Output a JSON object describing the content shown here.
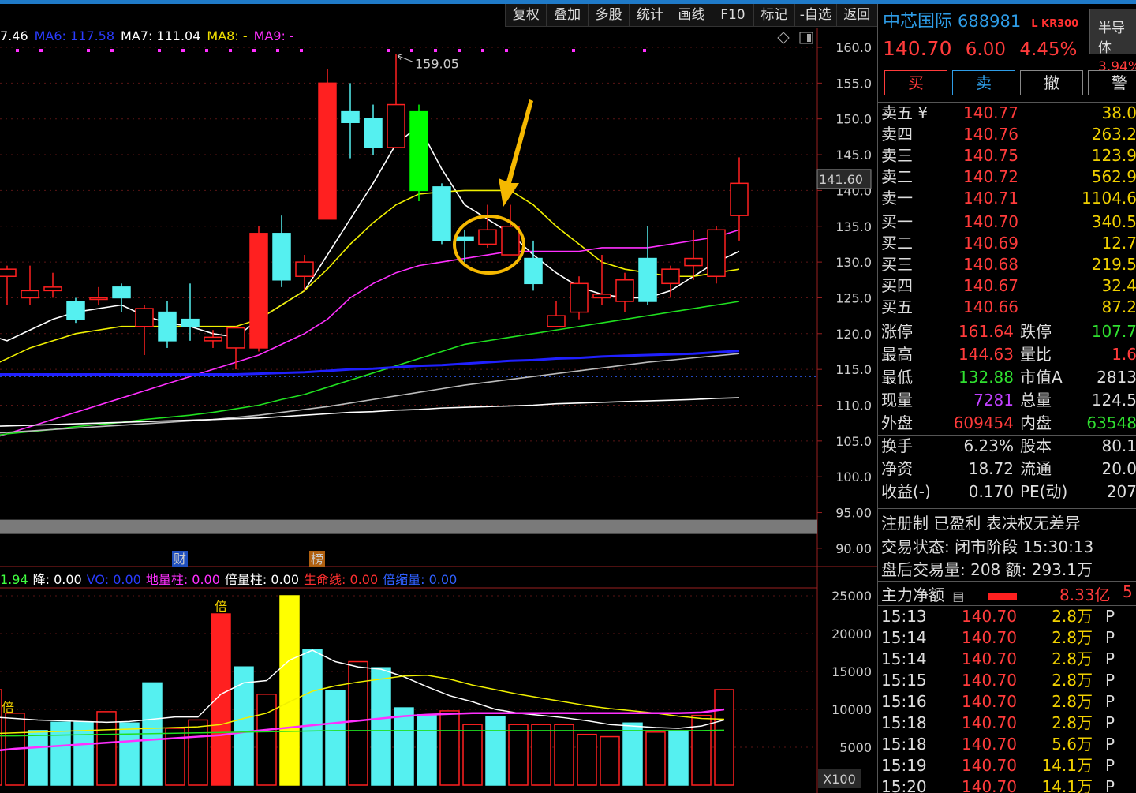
{
  "toolbar": [
    "复权",
    "叠加",
    "多股",
    "统计",
    "画线",
    "F10",
    "标记",
    "-自选",
    "返回"
  ],
  "ma_legend": [
    {
      "text": "7.46",
      "color": "#ffffff"
    },
    {
      "text": "MA6: 117.58",
      "color": "#2a3cff"
    },
    {
      "text": "MA7: 111.04",
      "color": "#ffffff"
    },
    {
      "text": "MA8: -",
      "color": "#f0e000"
    },
    {
      "text": "MA9: -",
      "color": "#ff30ff"
    }
  ],
  "indicator_legend": [
    {
      "text": "1.94",
      "color": "#40ff40"
    },
    {
      "text": "降: 0.00",
      "color": "#ffffff"
    },
    {
      "text": "VO: 0.00",
      "color": "#2a3cff"
    },
    {
      "text": "地量柱: 0.00",
      "color": "#ff30ff"
    },
    {
      "text": "倍量柱: 0.00",
      "color": "#ffffff"
    },
    {
      "text": "生命线: 0.00",
      "color": "#ff3030"
    },
    {
      "text": "倍缩量: 0.00",
      "color": "#3060ff"
    }
  ],
  "colors": {
    "up": "#ff2020",
    "down": "#55f0f0",
    "green": "#00ff00",
    "ma_white": "#ffffff",
    "ma_yellow": "#f0f000",
    "ma_magenta": "#ff30ff",
    "ma_green": "#20e020",
    "ma_blue": "#2020ff",
    "ma_gray": "#bbbbbb",
    "accent": "#f5b800"
  },
  "chart_data": [
    {
      "type": "candlestick",
      "ylim": [
        90,
        160
      ],
      "y_ticks": [
        "160.0",
        "155.0",
        "150.0",
        "145.0",
        "140.0",
        "135.0",
        "130.0",
        "125.0",
        "120.0",
        "115.0",
        "110.0",
        "105.0",
        "100.0",
        "95.00",
        "90.00"
      ],
      "last_price_label": "141.60",
      "high_annotation": "159.05",
      "dotted_level": 114.0,
      "candles": [
        {
          "o": 121.9,
          "c": 124.8,
          "h": 126.0,
          "l": 121.0
        },
        {
          "o": 128.0,
          "c": 129.0,
          "h": 129.5,
          "l": 124.0
        },
        {
          "o": 125.0,
          "c": 126.0,
          "h": 129.5,
          "l": 124.0
        },
        {
          "o": 126.0,
          "c": 126.5,
          "h": 128.5,
          "l": 125.0
        },
        {
          "o": 124.5,
          "c": 122.0,
          "h": 125.0,
          "l": 121.5
        },
        {
          "o": 125.0,
          "c": 125.0,
          "h": 126.5,
          "l": 124.0
        },
        {
          "o": 126.5,
          "c": 125.0,
          "h": 127.0,
          "l": 123.0
        },
        {
          "o": 121.0,
          "c": 123.5,
          "h": 124.0,
          "l": 117.0
        },
        {
          "o": 123.0,
          "c": 119.0,
          "h": 124.5,
          "l": 118.0
        },
        {
          "o": 122.0,
          "c": 121.0,
          "h": 127.0,
          "l": 119.0
        },
        {
          "o": 119.0,
          "c": 119.5,
          "h": 120.5,
          "l": 118.0
        },
        {
          "o": 118.0,
          "c": 120.8,
          "h": 121.0,
          "l": 115.0
        },
        {
          "o": 118.0,
          "c": 134.0,
          "h": 135.0,
          "l": 117.5
        },
        {
          "o": 134.0,
          "c": 127.5,
          "h": 136.5,
          "l": 126.5
        },
        {
          "o": 128.0,
          "c": 130.0,
          "h": 131.0,
          "l": 126.0
        },
        {
          "o": 136.0,
          "c": 155.0,
          "h": 157.0,
          "l": 136.0
        },
        {
          "o": 151.0,
          "c": 149.5,
          "h": 155.0,
          "l": 144.5
        },
        {
          "o": 150.0,
          "c": 146.0,
          "h": 152.0,
          "l": 145.0
        },
        {
          "o": 146.0,
          "c": 152.0,
          "h": 159.05,
          "l": 146.0
        },
        {
          "o": 151.0,
          "c": 140.0,
          "h": 152.0,
          "l": 138.5
        },
        {
          "o": 140.5,
          "c": 133.0,
          "h": 141.0,
          "l": 132.5
        },
        {
          "o": 133.5,
          "c": 133.0,
          "h": 134.5,
          "l": 130.0
        },
        {
          "o": 132.5,
          "c": 134.5,
          "h": 138.0,
          "l": 132.0
        },
        {
          "o": 131.0,
          "c": 135.0,
          "h": 138.0,
          "l": 131.0
        },
        {
          "o": 130.5,
          "c": 127.0,
          "h": 133.0,
          "l": 126.0
        },
        {
          "o": 121.0,
          "c": 122.5,
          "h": 124.5,
          "l": 121.0
        },
        {
          "o": 123.0,
          "c": 127.0,
          "h": 128.0,
          "l": 122.0
        },
        {
          "o": 125.0,
          "c": 125.5,
          "h": 131.0,
          "l": 124.0
        },
        {
          "o": 124.5,
          "c": 127.5,
          "h": 128.5,
          "l": 123.0
        },
        {
          "o": 130.5,
          "c": 124.5,
          "h": 135.0,
          "l": 124.0
        },
        {
          "o": 127.0,
          "c": 129.0,
          "h": 129.5,
          "l": 125.0
        },
        {
          "o": 129.5,
          "c": 130.5,
          "h": 134.5,
          "l": 127.5
        },
        {
          "o": 128.0,
          "c": 134.5,
          "h": 135.0,
          "l": 127.0
        },
        {
          "o": 136.5,
          "c": 141.0,
          "h": 144.63,
          "l": 133.0
        }
      ],
      "ma_lines": [
        {
          "color": "#ffffff",
          "values": [
            120,
            119,
            120.5,
            122,
            123,
            123.5,
            124,
            122.5,
            121.5,
            121,
            120,
            119.5,
            122,
            124,
            126,
            131,
            136,
            141,
            146.5,
            149,
            143,
            138,
            136,
            134,
            131,
            128.5,
            126.5,
            125.5,
            125,
            125,
            126,
            128,
            130,
            131.5
          ]
        },
        {
          "color": "#f0f000",
          "values": [
            115,
            116.5,
            118,
            119,
            120,
            120.5,
            121,
            121,
            121,
            121,
            121,
            121,
            122,
            124,
            126,
            129,
            132.5,
            135.5,
            138,
            139.5,
            139.8,
            140,
            140,
            140,
            138,
            135,
            132.5,
            130,
            129,
            128.5,
            128,
            128,
            128.5,
            129
          ]
        },
        {
          "color": "#ff30ff",
          "values": [
            105,
            106,
            107,
            108,
            109,
            110,
            111,
            112,
            113,
            114,
            115,
            116,
            117,
            118.5,
            120,
            122,
            125,
            127,
            128.5,
            129.5,
            130,
            130.5,
            131,
            131.5,
            131.5,
            131.5,
            131.5,
            132,
            132,
            132,
            132.5,
            133,
            133.5,
            134.5
          ]
        },
        {
          "color": "#20e020",
          "values": [
            105.5,
            106,
            106.3,
            106.6,
            107,
            107.3,
            107.6,
            108,
            108.3,
            108.6,
            109,
            109.5,
            110,
            110.8,
            111.5,
            112.5,
            113.5,
            114.5,
            115.5,
            116.5,
            117.5,
            118.5,
            119,
            119.5,
            120,
            120.5,
            121,
            121.5,
            122,
            122.5,
            123,
            123.5,
            124,
            124.5
          ]
        },
        {
          "color": "#2020ff",
          "values": [
            114.3,
            114.3,
            114.3,
            114.3,
            114.3,
            114.3,
            114.3,
            114.3,
            114.3,
            114.3,
            114.3,
            114.3,
            114.4,
            114.5,
            114.6,
            114.8,
            115,
            115.1,
            115.3,
            115.5,
            115.6,
            115.8,
            116,
            116.2,
            116.3,
            116.5,
            116.6,
            116.8,
            116.9,
            117,
            117.1,
            117.2,
            117.4,
            117.58
          ]
        },
        {
          "color": "#bbbbbb",
          "values": [
            106,
            106.2,
            106.4,
            106.6,
            106.8,
            107,
            107.2,
            107.4,
            107.6,
            107.8,
            108,
            108.3,
            108.6,
            109,
            109.4,
            109.8,
            110.3,
            110.8,
            111.3,
            111.8,
            112.3,
            112.8,
            113.2,
            113.6,
            114,
            114.4,
            114.8,
            115.2,
            115.6,
            116,
            116.3,
            116.6,
            116.9,
            117.2
          ]
        },
        {
          "color": "#ffffff",
          "values": [
            107,
            107.1,
            107.2,
            107.3,
            107.4,
            107.5,
            107.6,
            107.7,
            107.8,
            107.9,
            108,
            108.1,
            108.2,
            108.4,
            108.6,
            108.8,
            109,
            109.1,
            109.3,
            109.4,
            109.6,
            109.7,
            109.8,
            109.9,
            110,
            110.2,
            110.3,
            110.4,
            110.5,
            110.6,
            110.7,
            110.8,
            110.95,
            111.04
          ]
        }
      ]
    },
    {
      "type": "bar",
      "title": "",
      "ylim": [
        0,
        25000
      ],
      "y_ticks": [
        "25000",
        "20000",
        "15000",
        "10000",
        "5000"
      ],
      "unit_label": "X100",
      "markers": [
        "财",
        "榜",
        "倍",
        "倍"
      ],
      "bars": [
        {
          "v": 12600,
          "k": "up"
        },
        {
          "v": 9500,
          "k": "up"
        },
        {
          "v": 7200,
          "k": "down"
        },
        {
          "v": 8300,
          "k": "down"
        },
        {
          "v": 8300,
          "k": "down"
        },
        {
          "v": 9700,
          "k": "up"
        },
        {
          "v": 8200,
          "k": "down"
        },
        {
          "v": 13500,
          "k": "down"
        },
        {
          "v": 7500,
          "k": "up"
        },
        {
          "v": 8600,
          "k": "up"
        },
        {
          "v": 22600,
          "k": "red"
        },
        {
          "v": 15600,
          "k": "down"
        },
        {
          "v": 12000,
          "k": "up"
        },
        {
          "v": 25000,
          "k": "yellow"
        },
        {
          "v": 17900,
          "k": "down"
        },
        {
          "v": 12500,
          "k": "down"
        },
        {
          "v": 16300,
          "k": "up"
        },
        {
          "v": 15500,
          "k": "down"
        },
        {
          "v": 10200,
          "k": "down"
        },
        {
          "v": 9300,
          "k": "down"
        },
        {
          "v": 9800,
          "k": "up"
        },
        {
          "v": 8000,
          "k": "up"
        },
        {
          "v": 9000,
          "k": "down"
        },
        {
          "v": 8000,
          "k": "up"
        },
        {
          "v": 8000,
          "k": "up"
        },
        {
          "v": 8000,
          "k": "up"
        },
        {
          "v": 6700,
          "k": "up"
        },
        {
          "v": 6400,
          "k": "up"
        },
        {
          "v": 8200,
          "k": "down"
        },
        {
          "v": 7000,
          "k": "up"
        },
        {
          "v": 7200,
          "k": "down"
        },
        {
          "v": 9200,
          "k": "up"
        },
        {
          "v": 12600,
          "k": "up"
        }
      ],
      "lines": [
        {
          "color": "#ffffff",
          "values": [
            9000,
            8800,
            8600,
            8500,
            8400,
            8300,
            8400,
            8700,
            9000,
            9000,
            12000,
            13500,
            13800,
            16500,
            17800,
            16300,
            15600,
            15300,
            14300,
            13000,
            11800,
            11000,
            10000,
            9500,
            9200,
            8900,
            8500,
            8000,
            7800,
            7600,
            7500,
            7800,
            8600
          ]
        },
        {
          "color": "#f0f000",
          "values": [
            6800,
            6900,
            7000,
            7100,
            7200,
            7300,
            7400,
            7500,
            7600,
            7700,
            8000,
            8800,
            9500,
            11000,
            12400,
            13100,
            13600,
            14000,
            14400,
            14500,
            14000,
            13200,
            12600,
            12000,
            11500,
            11000,
            10500,
            10100,
            9800,
            9500,
            9100,
            8800,
            8700
          ]
        },
        {
          "color": "#ff30ff",
          "values": [
            4500,
            4800,
            5000,
            5200,
            5400,
            5600,
            5800,
            6000,
            6200,
            6400,
            6600,
            7000,
            7300,
            7600,
            7900,
            8200,
            8500,
            8800,
            9100,
            9300,
            9400,
            9500,
            9500,
            9500,
            9500,
            9500,
            9500,
            9500,
            9500,
            9500,
            9500,
            9600,
            10000
          ]
        },
        {
          "color": "#20e020",
          "values": [
            6500,
            6500,
            6550,
            6600,
            6650,
            6700,
            6750,
            6800,
            6850,
            6900,
            6950,
            7000,
            7050,
            7100,
            7150,
            7200,
            7200,
            7200,
            7200,
            7200,
            7200,
            7200,
            7200,
            7200,
            7200,
            7200,
            7200,
            7200,
            7200,
            7200,
            7200,
            7200,
            7250
          ]
        }
      ]
    }
  ],
  "panel": {
    "name": "中芯国际",
    "code": "688981",
    "tags": "L KR300",
    "sector": "半导体",
    "sector_chg": "3.94%",
    "price": "140.70",
    "change": "6.00",
    "pct": "4.45%",
    "buttons": [
      "买",
      "卖",
      "撤",
      "警"
    ],
    "asks": [
      {
        "label": "卖五 ¥",
        "price": "140.77",
        "vol": "38.0"
      },
      {
        "label": "卖四",
        "price": "140.76",
        "vol": "263.2"
      },
      {
        "label": "卖三",
        "price": "140.75",
        "vol": "123.9"
      },
      {
        "label": "卖二",
        "price": "140.72",
        "vol": "562.9"
      },
      {
        "label": "卖一",
        "price": "140.71",
        "vol": "1104.6"
      }
    ],
    "bids": [
      {
        "label": "买一",
        "price": "140.70",
        "vol": "340.5"
      },
      {
        "label": "买二",
        "price": "140.69",
        "vol": "12.7"
      },
      {
        "label": "买三",
        "price": "140.68",
        "vol": "219.5"
      },
      {
        "label": "买四",
        "price": "140.67",
        "vol": "32.4"
      },
      {
        "label": "买五",
        "price": "140.66",
        "vol": "87.2"
      }
    ],
    "stats1": [
      {
        "l1": "涨停",
        "v1": "161.64",
        "c1": "#ff3b3b",
        "l2": "跌停",
        "v2": "107.7",
        "c2": "#30e030"
      },
      {
        "l1": "最高",
        "v1": "144.63",
        "c1": "#ff3b3b",
        "l2": "量比",
        "v2": "1.6",
        "c2": "#ff3b3b"
      },
      {
        "l1": "最低",
        "v1": "132.88",
        "c1": "#30e030",
        "l2": "市值A",
        "v2": "2813",
        "c2": "#dddddd"
      },
      {
        "l1": "现量",
        "v1": "7281",
        "c1": "#c040ff",
        "l2": "总量",
        "v2": "124.5",
        "c2": "#dddddd"
      },
      {
        "l1": "外盘",
        "v1": "609454",
        "c1": "#ff3b3b",
        "l2": "内盘",
        "v2": "63548",
        "c2": "#30e030"
      }
    ],
    "stats2": [
      {
        "l1": "换手",
        "v1": "6.23%",
        "c1": "#dddddd",
        "l2": "股本",
        "v2": "80.1",
        "c2": "#dddddd"
      },
      {
        "l1": "净资",
        "v1": "18.72",
        "c1": "#dddddd",
        "l2": "流通",
        "v2": "20.0",
        "c2": "#dddddd"
      },
      {
        "l1": "收益(-)",
        "v1": "0.170",
        "c1": "#dddddd",
        "l2": "PE(动)",
        "v2": "207",
        "c2": "#dddddd"
      }
    ],
    "info1": "注册制 已盈利 表决权无差异",
    "info2": "交易状态: 闭市阶段 15:30:13",
    "info3": "盘后交易量: 208  额: 293.1万",
    "flow_label": "主力净额",
    "flow_value": "8.33亿",
    "flow_extra": "5",
    "ticks": [
      {
        "t": "15:13",
        "p": "140.70",
        "v": "2.8万",
        "f": "P"
      },
      {
        "t": "15:14",
        "p": "140.70",
        "v": "2.8万",
        "f": "P"
      },
      {
        "t": "15:14",
        "p": "140.70",
        "v": "2.8万",
        "f": "P"
      },
      {
        "t": "15:15",
        "p": "140.70",
        "v": "2.8万",
        "f": "P"
      },
      {
        "t": "15:16",
        "p": "140.70",
        "v": "2.8万",
        "f": "P"
      },
      {
        "t": "15:18",
        "p": "140.70",
        "v": "2.8万",
        "f": "P"
      },
      {
        "t": "15:18",
        "p": "140.70",
        "v": "5.6万",
        "f": "P"
      },
      {
        "t": "15:19",
        "p": "140.70",
        "v": "14.1万",
        "f": "P"
      },
      {
        "t": "15:20",
        "p": "140.70",
        "v": "14.1万",
        "f": "P"
      }
    ]
  }
}
